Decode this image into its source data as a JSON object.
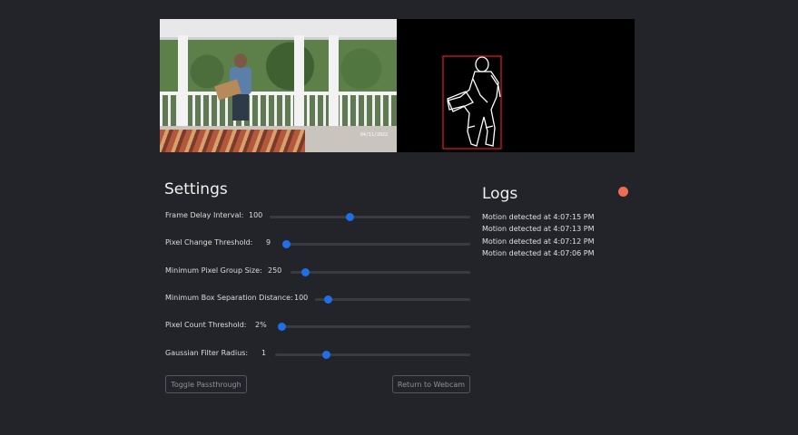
{
  "video": {
    "timestamp_text": "04/11/2022",
    "mask_box_color": "#e02020"
  },
  "settings": {
    "title": "Settings",
    "sliders": [
      {
        "label": "Frame Delay Interval:",
        "value": "100",
        "fraction": 0.4
      },
      {
        "label": "Pixel Change Threshold:",
        "value": "9",
        "fraction": 0.01
      },
      {
        "label": "Minimum Pixel Group Size:",
        "value": "250",
        "fraction": 0.08
      },
      {
        "label": "Minimum Box Separation Distance:",
        "value": "100",
        "fraction": 0.08
      },
      {
        "label": "Pixel Count Threshold:",
        "value": "2%",
        "fraction": 0.02
      },
      {
        "label": "Gaussian Filter Radius:",
        "value": "1",
        "fraction": 0.26
      }
    ],
    "toggle_passthrough": "Toggle Passthrough",
    "return_to_webcam": "Return to Webcam"
  },
  "logs": {
    "title": "Logs",
    "status_color": "#ee6b55",
    "entries": [
      "Motion detected at 4:07:15 PM",
      "Motion detected at 4:07:13 PM",
      "Motion detected at 4:07:12 PM",
      "Motion detected at 4:07:06 PM"
    ]
  },
  "colors": {
    "background": "#232429",
    "accent": "#1f6fe6"
  }
}
